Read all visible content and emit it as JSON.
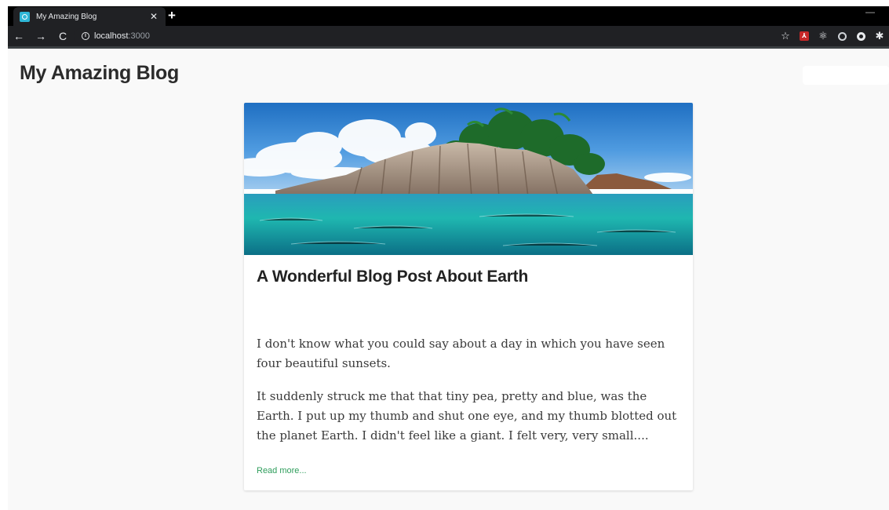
{
  "browser": {
    "tab_title": "My Amazing Blog",
    "tab_close": "✕",
    "new_tab": "+",
    "url_host": "localhost",
    "url_port": ":3000"
  },
  "blog": {
    "title": "My Amazing Blog"
  },
  "post": {
    "title": "A Wonderful Blog Post About Earth",
    "paragraphs": [
      "I don't know what you could say about a day in which you have seen four beautiful sunsets.",
      "It suddenly struck me that that tiny pea, pretty and blue, was the Earth. I put up my thumb and shut one eye, and my thumb blotted out the planet Earth. I didn't feel like a giant. I felt very, very small...."
    ],
    "read_more": "Read more..."
  },
  "colors": {
    "accent_link": "#2e9d5b",
    "chrome_bg": "#202124",
    "page_bg": "#f9f9f9"
  },
  "icons": [
    "back-icon",
    "forward-icon",
    "reload-icon",
    "info-icon",
    "star-icon",
    "pdf-icon",
    "ring-icon",
    "dot-icon",
    "puzzle-icon"
  ]
}
